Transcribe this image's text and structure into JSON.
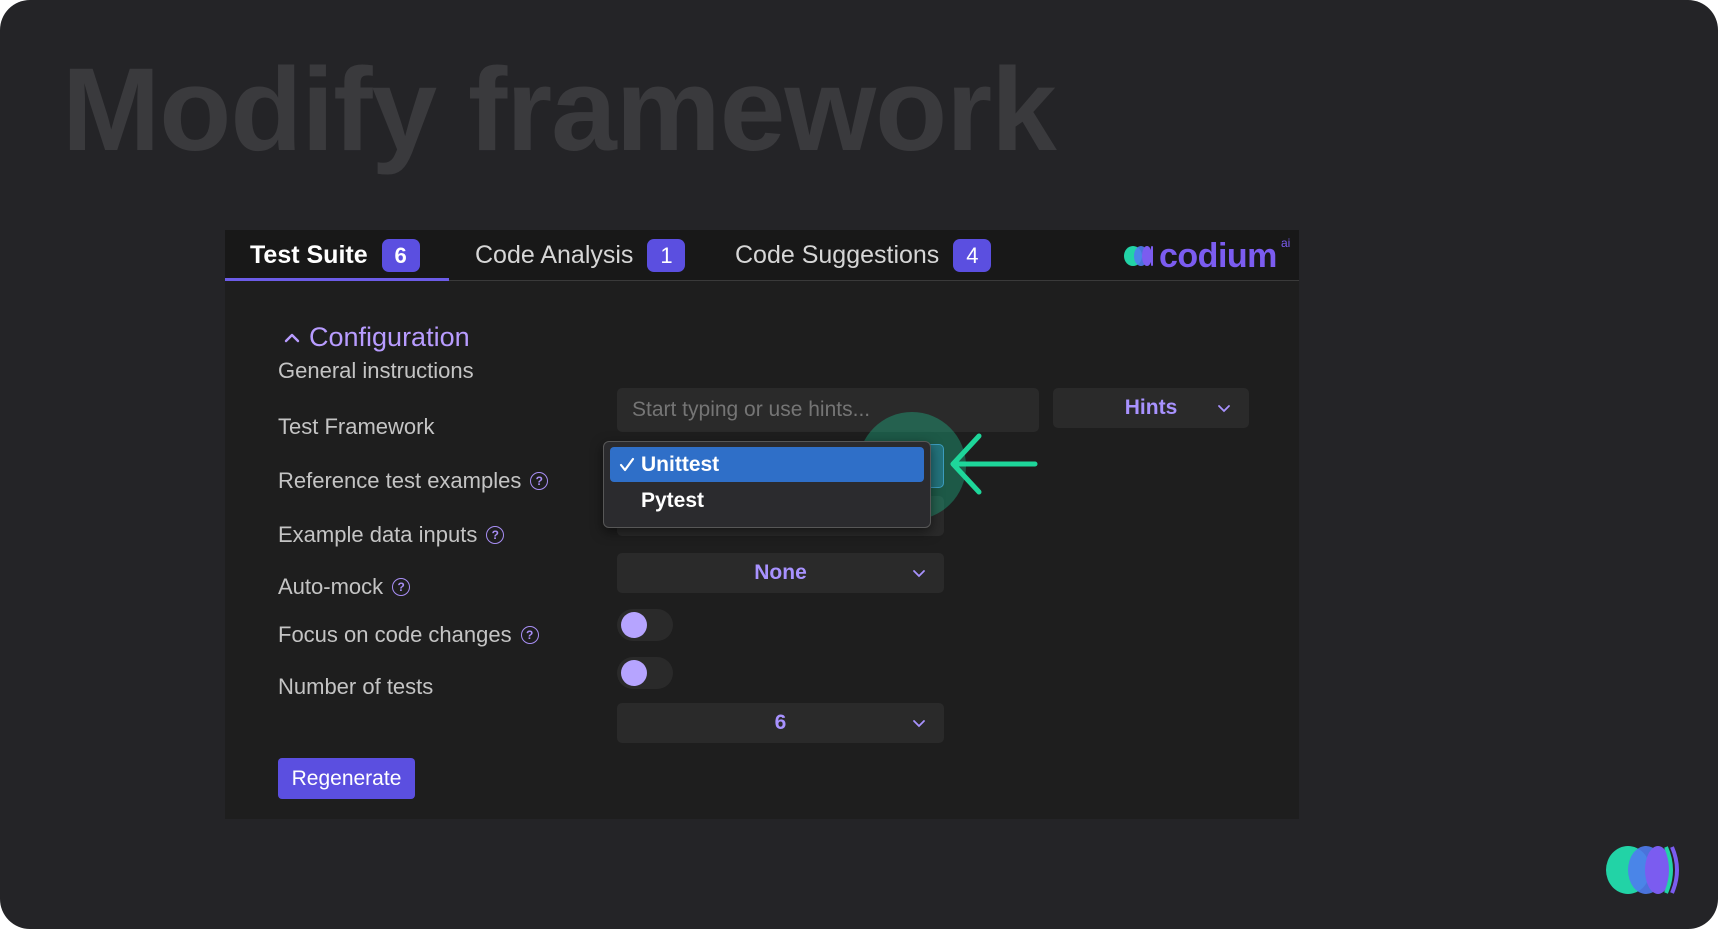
{
  "page": {
    "headline": "Modify framework"
  },
  "tabs": [
    {
      "label": "Test Suite",
      "badge": "6"
    },
    {
      "label": "Code Analysis",
      "badge": "1"
    },
    {
      "label": "Code Suggestions",
      "badge": "4"
    }
  ],
  "brand": {
    "name": "codium",
    "superscript": "ai",
    "color": "#7b5cf0"
  },
  "configuration": {
    "title": "Configuration",
    "general_instructions": {
      "label": "General instructions",
      "placeholder": "Start typing or use hints...",
      "hints_label": "Hints"
    },
    "test_framework": {
      "label": "Test Framework",
      "options": [
        "Unittest",
        "Pytest"
      ],
      "selected": "Unittest"
    },
    "reference_test_examples": {
      "label": "Reference test examples"
    },
    "example_data_inputs": {
      "label": "Example data inputs",
      "value": "None"
    },
    "auto_mock": {
      "label": "Auto-mock",
      "enabled": false
    },
    "focus_on_code_changes": {
      "label": "Focus on code changes",
      "enabled": false
    },
    "number_of_tests": {
      "label": "Number of tests",
      "value": "6"
    },
    "regenerate_label": "Regenerate"
  },
  "colors": {
    "accent": "#5b4fe0",
    "highlight": "#2f6fc8",
    "annotation": "#1ed69a"
  }
}
